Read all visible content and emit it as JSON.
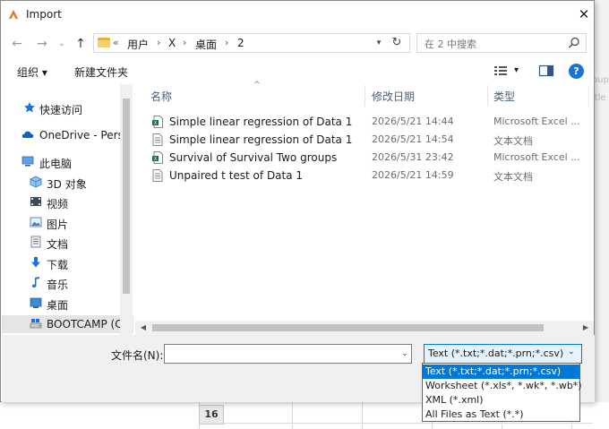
{
  "dialog": {
    "title": "Import",
    "close_glyph": "✕"
  },
  "nav": {
    "back_glyph": "←",
    "forward_glyph": "→",
    "recent_glyph": "⌄",
    "up_glyph": "↑"
  },
  "address": {
    "overflow": "«",
    "crumbs": [
      "用户",
      "X",
      "桌面",
      "2"
    ],
    "sep": "›",
    "dropdown_glyph": "▾",
    "refresh_glyph": "↻"
  },
  "search": {
    "placeholder": "在 2 中搜索"
  },
  "toolbar": {
    "organize_label": "组织 ▾",
    "new_folder_label": "新建文件夹",
    "view_dd_glyph": "▾",
    "help_glyph": "?"
  },
  "left_nav": {
    "items": [
      {
        "label": "快速访问",
        "icon": "pin-icon"
      },
      {
        "label": "OneDrive - Perso",
        "icon": "cloud-icon"
      },
      {
        "label": "此电脑",
        "icon": "computer-icon"
      },
      {
        "label": "3D 对象",
        "icon": "cube-icon"
      },
      {
        "label": "视频",
        "icon": "video-icon"
      },
      {
        "label": "图片",
        "icon": "picture-icon"
      },
      {
        "label": "文档",
        "icon": "document-icon"
      },
      {
        "label": "下载",
        "icon": "download-icon"
      },
      {
        "label": "音乐",
        "icon": "music-icon"
      },
      {
        "label": "桌面",
        "icon": "desktop-icon"
      },
      {
        "label": "BOOTCAMP (C",
        "icon": "drive-icon"
      }
    ]
  },
  "file_list": {
    "columns": {
      "name": "名称",
      "date": "修改日期",
      "type": "类型"
    },
    "sort_glyph": "^",
    "rows": [
      {
        "name": "Simple linear regression of Data 1",
        "date": "2026/5/21 14:44",
        "type": "Microsoft Excel ...",
        "icon": "excel-file-icon"
      },
      {
        "name": "Simple linear regression of Data 1",
        "date": "2026/5/21 14:54",
        "type": "文本文档",
        "icon": "text-file-icon"
      },
      {
        "name": "Survival of Survival Two groups",
        "date": "2026/5/31 23:42",
        "type": "Microsoft Excel ...",
        "icon": "excel-file-icon"
      },
      {
        "name": "Unpaired t test of Data 1",
        "date": "2026/5/21 14:59",
        "type": "文本文档",
        "icon": "text-file-icon"
      }
    ],
    "scroll_left_glyph": "◀",
    "scroll_right_glyph": "▶"
  },
  "bottom": {
    "filename_label": "文件名(N):",
    "filename_value": "",
    "filename_dd_glyph": "⌄",
    "filetype_selected": "Text (*.txt;*.dat;*.prn;*.csv)",
    "filetype_dd_glyph": "⌄",
    "filetype_options": [
      "Text (*.txt;*.dat;*.prn;*.csv)",
      "Worksheet (*.xls*, *.wk*, *.wb*)",
      "XML (*.xml)",
      "All Files as Text (*.*)"
    ]
  },
  "background_sheet": {
    "row_number": "16",
    "cut_text_1": "oup",
    "cut_text_2": "itle"
  },
  "colors": {
    "accent": "#0078d7",
    "help_blue": "#1a73d9",
    "excel_green": "#1d7044",
    "folder_yellow": "#f4d06a"
  }
}
